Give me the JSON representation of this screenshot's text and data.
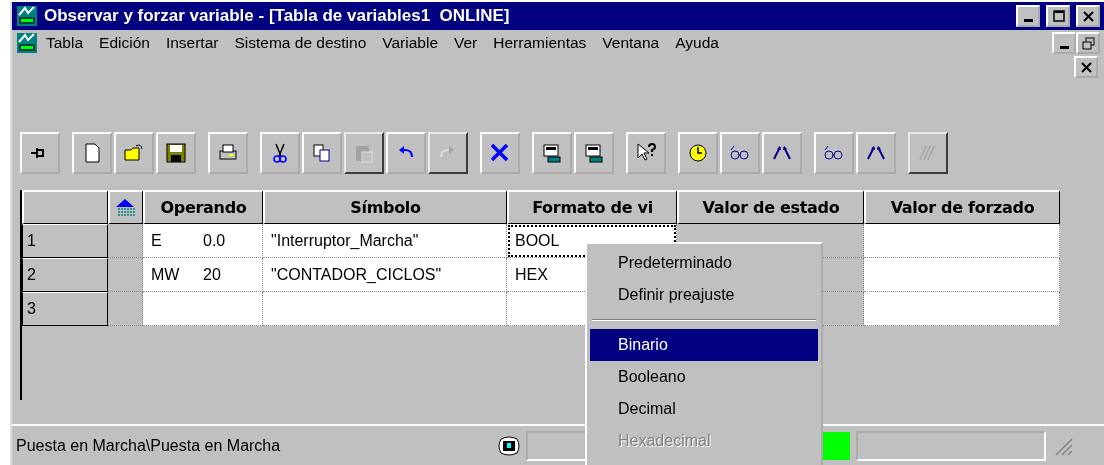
{
  "window": {
    "title": "Observar y forzar variable - [Tabla de variables1  ONLINE]"
  },
  "menu_bar": [
    "Tabla",
    "Edición",
    "Insertar",
    "Sistema de destino",
    "Variable",
    "Ver",
    "Herramientas",
    "Ventana",
    "Ayuda"
  ],
  "toolbar": [
    [
      {
        "kind": "pin",
        "disabled": false
      }
    ],
    [
      {
        "kind": "new",
        "disabled": false
      },
      {
        "kind": "open",
        "disabled": false
      },
      {
        "kind": "save",
        "disabled": false
      }
    ],
    [
      {
        "kind": "print",
        "disabled": false
      }
    ],
    [
      {
        "kind": "cut",
        "disabled": false
      },
      {
        "kind": "copy",
        "disabled": false
      },
      {
        "kind": "paste",
        "disabled": true
      },
      {
        "kind": "undo",
        "disabled": false
      },
      {
        "kind": "redo",
        "disabled": true
      }
    ],
    [
      {
        "kind": "delete",
        "disabled": false
      }
    ],
    [
      {
        "kind": "monitor",
        "disabled": false
      },
      {
        "kind": "monitor",
        "disabled": false
      }
    ],
    [
      {
        "kind": "help",
        "disabled": false
      }
    ],
    [
      {
        "kind": "clock",
        "disabled": false
      },
      {
        "kind": "glasses",
        "disabled": false
      },
      {
        "kind": "arrows",
        "disabled": false
      }
    ],
    [
      {
        "kind": "glasses",
        "disabled": false
      },
      {
        "kind": "arrows",
        "disabled": false
      }
    ],
    [
      {
        "kind": "hatch",
        "disabled": true
      }
    ]
  ],
  "table": {
    "columns": [
      "Operando",
      "Símbolo",
      "Formato de vi",
      "Valor de estado",
      "Valor de forzado"
    ],
    "rows": [
      {
        "number": "1",
        "operand": "E",
        "address": "0.0",
        "symbol": "\"Interruptor_Marcha\"",
        "format": "BOOL",
        "focused": true
      },
      {
        "number": "2",
        "operand": "MW",
        "address": "20",
        "symbol": "\"CONTADOR_CICLOS\"",
        "format": "HEX",
        "focused": false
      },
      {
        "number": "3",
        "focused": false
      }
    ]
  },
  "context_menu": [
    {
      "kind": "item",
      "label": "Predeterminado",
      "selected": false,
      "disabled": false
    },
    {
      "kind": "item",
      "label": "Definir preajuste",
      "selected": false,
      "disabled": false
    },
    {
      "kind": "separator"
    },
    {
      "kind": "item",
      "label": "Binario",
      "selected": true,
      "disabled": false
    },
    {
      "kind": "item",
      "label": "Booleano",
      "selected": false,
      "disabled": false
    },
    {
      "kind": "item",
      "label": "Decimal",
      "selected": false,
      "disabled": false
    },
    {
      "kind": "item",
      "label": "Hexadecimal",
      "selected": false,
      "disabled": true
    }
  ],
  "status_bar": {
    "path": "Puesta en Marcha\\Puesta en Marcha",
    "online_light": true
  }
}
